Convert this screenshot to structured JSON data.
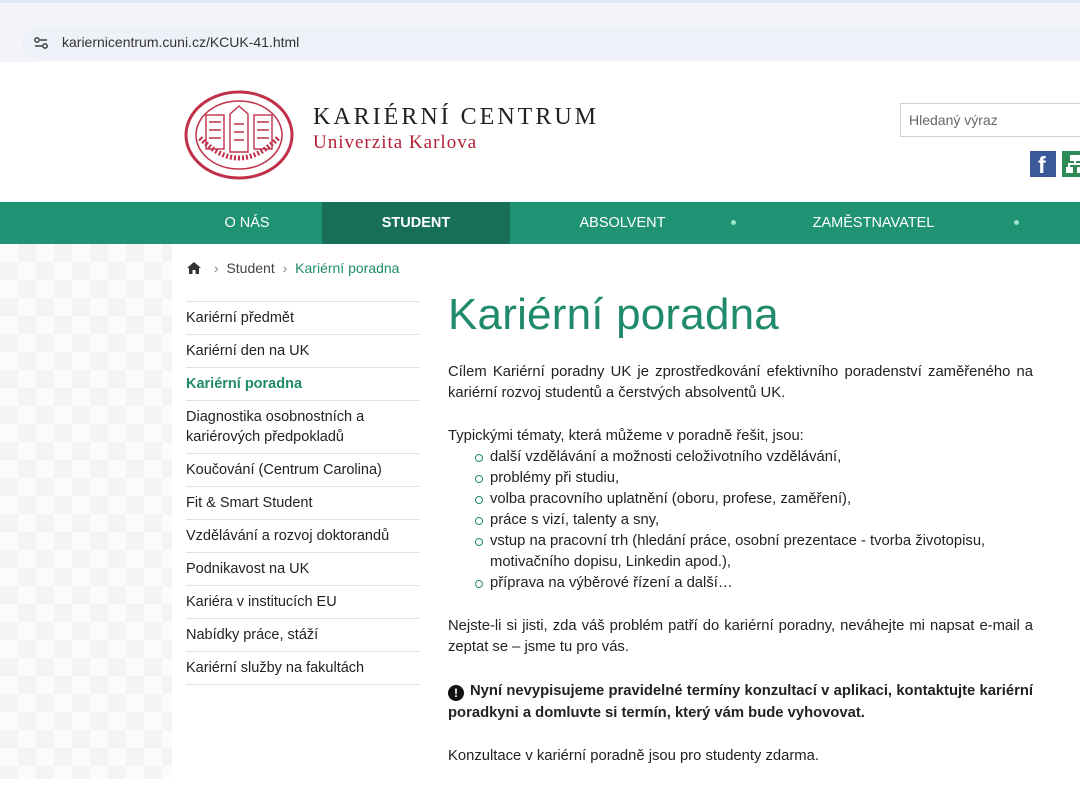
{
  "browser": {
    "url": "kariernicentrum.cuni.cz/KCUK-41.html"
  },
  "header": {
    "title": "KARIÉRNÍ CENTRUM",
    "subtitle": "Univerzita Karlova",
    "search_placeholder": "Hledaný výraz"
  },
  "nav": {
    "items": [
      {
        "label": "O NÁS"
      },
      {
        "label": "STUDENT"
      },
      {
        "label": "ABSOLVENT"
      },
      {
        "label": "ZAMĚSTNAVATEL"
      }
    ]
  },
  "breadcrumb": {
    "student": "Student",
    "current": "Kariérní poradna"
  },
  "sidebar": {
    "items": [
      "Kariérní předmět",
      "Kariérní den na UK",
      "Kariérní poradna",
      "Diagnostika osobnostních a kariérových předpokladů",
      "Koučování (Centrum Carolina)",
      "Fit & Smart Student",
      "Vzdělávání a rozvoj doktorandů",
      "Podnikavost na UK",
      "Kariéra v institucích EU",
      "Nabídky práce, stáží",
      "Kariérní služby na fakultách"
    ]
  },
  "content": {
    "heading": "Kariérní poradna",
    "intro": "Cílem Kariérní poradny UK je zprostředkování efektivního poradenství zaměřeného na kariérní rozvoj studentů a čerstvých absolventů UK.",
    "list_intro": "Typickými tématy, která můžeme v poradně řešit, jsou:",
    "topics": [
      "další vzdělávání a možnosti celoživotního vzdělávání,",
      "problémy při studiu,",
      "volba pracovního uplatnění (oboru, profese, zaměření),",
      "práce s vizí, talenty a sny,",
      "vstup na pracovní trh (hledání práce, osobní prezentace - tvorba životopisu, motivačního dopisu, Linkedin apod.),",
      "příprava na výběrové řízení a další…"
    ],
    "contact": "Nejste-li si jisti, zda váš problém patří do kariérní poradny, neváhejte mi napsat e-mail a zeptat se – jsme tu pro vás.",
    "notice": "Nyní nevypisujeme pravidelné termíny konzultací v aplikaci, kontaktujte kariérní poradkyni a domluvte si termín, který vám bude vyhovovat.",
    "free_note": "Konzultace v kariérní poradně jsou pro studenty zdarma."
  },
  "colors": {
    "brand_green": "#1f9373",
    "active_green": "#176f57",
    "heading_green": "#1f8a6c",
    "university_red": "#b21e35"
  },
  "icons": {
    "site_settings": "site-settings-icon",
    "home": "home-icon",
    "facebook": "facebook-icon",
    "sitemap": "sitemap-icon",
    "warning": "warning-icon"
  }
}
